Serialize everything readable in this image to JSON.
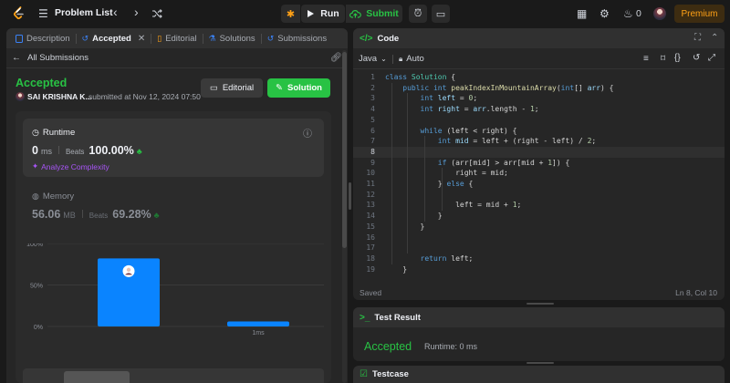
{
  "topbar": {
    "title": "Problem List",
    "run_label": "Run",
    "submit_label": "Submit",
    "streak_count": "0",
    "premium_label": "Premium"
  },
  "left_tabs": [
    {
      "label": "Description"
    },
    {
      "label": "Accepted"
    },
    {
      "label": "Editorial"
    },
    {
      "label": "Solutions"
    },
    {
      "label": "Submissions"
    }
  ],
  "submission": {
    "back_label": "All Submissions",
    "status": "Accepted",
    "user": "SAI KRISHNA K...",
    "submitted_at": "submitted at Nov 12, 2024 07:50",
    "editorial_button": "Editorial",
    "solution_button": "Solution"
  },
  "runtime": {
    "title": "Runtime",
    "value": "0",
    "unit": "ms",
    "beats_label": "Beats",
    "beats_value": "100.00%",
    "analyze_label": "Analyze Complexity"
  },
  "memory": {
    "title": "Memory",
    "value": "56.06",
    "unit": "MB",
    "beats_label": "Beats",
    "beats_value": "69.28%"
  },
  "chart_data": {
    "type": "bar",
    "yticks": [
      "100%",
      "50%",
      "0%"
    ],
    "ylim": [
      0,
      100
    ],
    "categories": [
      "",
      "1ms"
    ],
    "values": [
      82,
      6
    ],
    "colors": [
      "#0a84ff",
      "#0a84ff"
    ]
  },
  "editor": {
    "title": "Code",
    "language": "Java",
    "auto_label": "Auto",
    "status": "Saved",
    "cursor": "Ln 8, Col 10",
    "lines": [
      [
        {
          "t": "class ",
          "c": "kw"
        },
        {
          "t": "Solution",
          "c": "cls"
        },
        {
          "t": " {",
          "c": "p"
        }
      ],
      [
        {
          "t": "    ",
          "c": "p"
        },
        {
          "t": "public int ",
          "c": "kw"
        },
        {
          "t": "peakIndexInMountainArray",
          "c": "fn"
        },
        {
          "t": "(",
          "c": "p"
        },
        {
          "t": "int",
          "c": "kw"
        },
        {
          "t": "[] ",
          "c": "p"
        },
        {
          "t": "arr",
          "c": "var"
        },
        {
          "t": ") {",
          "c": "p"
        }
      ],
      [
        {
          "t": "        ",
          "c": "p"
        },
        {
          "t": "int ",
          "c": "kw"
        },
        {
          "t": "left",
          "c": "var"
        },
        {
          "t": " = ",
          "c": "p"
        },
        {
          "t": "0",
          "c": "num"
        },
        {
          "t": ";",
          "c": "p"
        }
      ],
      [
        {
          "t": "        ",
          "c": "p"
        },
        {
          "t": "int ",
          "c": "kw"
        },
        {
          "t": "right",
          "c": "var"
        },
        {
          "t": " = ",
          "c": "p"
        },
        {
          "t": "arr",
          "c": "var"
        },
        {
          "t": ".length - ",
          "c": "p"
        },
        {
          "t": "1",
          "c": "num"
        },
        {
          "t": ";",
          "c": "p"
        }
      ],
      [],
      [
        {
          "t": "        ",
          "c": "p"
        },
        {
          "t": "while ",
          "c": "kw"
        },
        {
          "t": "(left < right) {",
          "c": "p"
        }
      ],
      [
        {
          "t": "            ",
          "c": "p"
        },
        {
          "t": "int ",
          "c": "kw"
        },
        {
          "t": "mid",
          "c": "var"
        },
        {
          "t": " = left + (right - left) / ",
          "c": "p"
        },
        {
          "t": "2",
          "c": "num"
        },
        {
          "t": ";",
          "c": "p"
        }
      ],
      [],
      [
        {
          "t": "            ",
          "c": "p"
        },
        {
          "t": "if ",
          "c": "kw"
        },
        {
          "t": "(arr[mid] > arr[mid + ",
          "c": "p"
        },
        {
          "t": "1",
          "c": "num"
        },
        {
          "t": "]) {",
          "c": "p"
        }
      ],
      [
        {
          "t": "                right = mid;",
          "c": "p"
        }
      ],
      [
        {
          "t": "            } ",
          "c": "p"
        },
        {
          "t": "else ",
          "c": "kw"
        },
        {
          "t": "{",
          "c": "p"
        }
      ],
      [],
      [
        {
          "t": "                left = mid + ",
          "c": "p"
        },
        {
          "t": "1",
          "c": "num"
        },
        {
          "t": ";",
          "c": "p"
        }
      ],
      [
        {
          "t": "            }",
          "c": "p"
        }
      ],
      [
        {
          "t": "        }",
          "c": "p"
        }
      ],
      [],
      [],
      [
        {
          "t": "        ",
          "c": "p"
        },
        {
          "t": "return ",
          "c": "kw"
        },
        {
          "t": "left;",
          "c": "p"
        }
      ],
      [
        {
          "t": "    }",
          "c": "p"
        }
      ]
    ],
    "current_line": 8
  },
  "test_result": {
    "title": "Test Result",
    "status": "Accepted",
    "runtime_label": "Runtime: 0 ms"
  },
  "testcase": {
    "title": "Testcase"
  },
  "colors": {
    "accent_orange": "#ffa116",
    "accepted_green": "#28c244",
    "bar_blue": "#0a84ff"
  }
}
